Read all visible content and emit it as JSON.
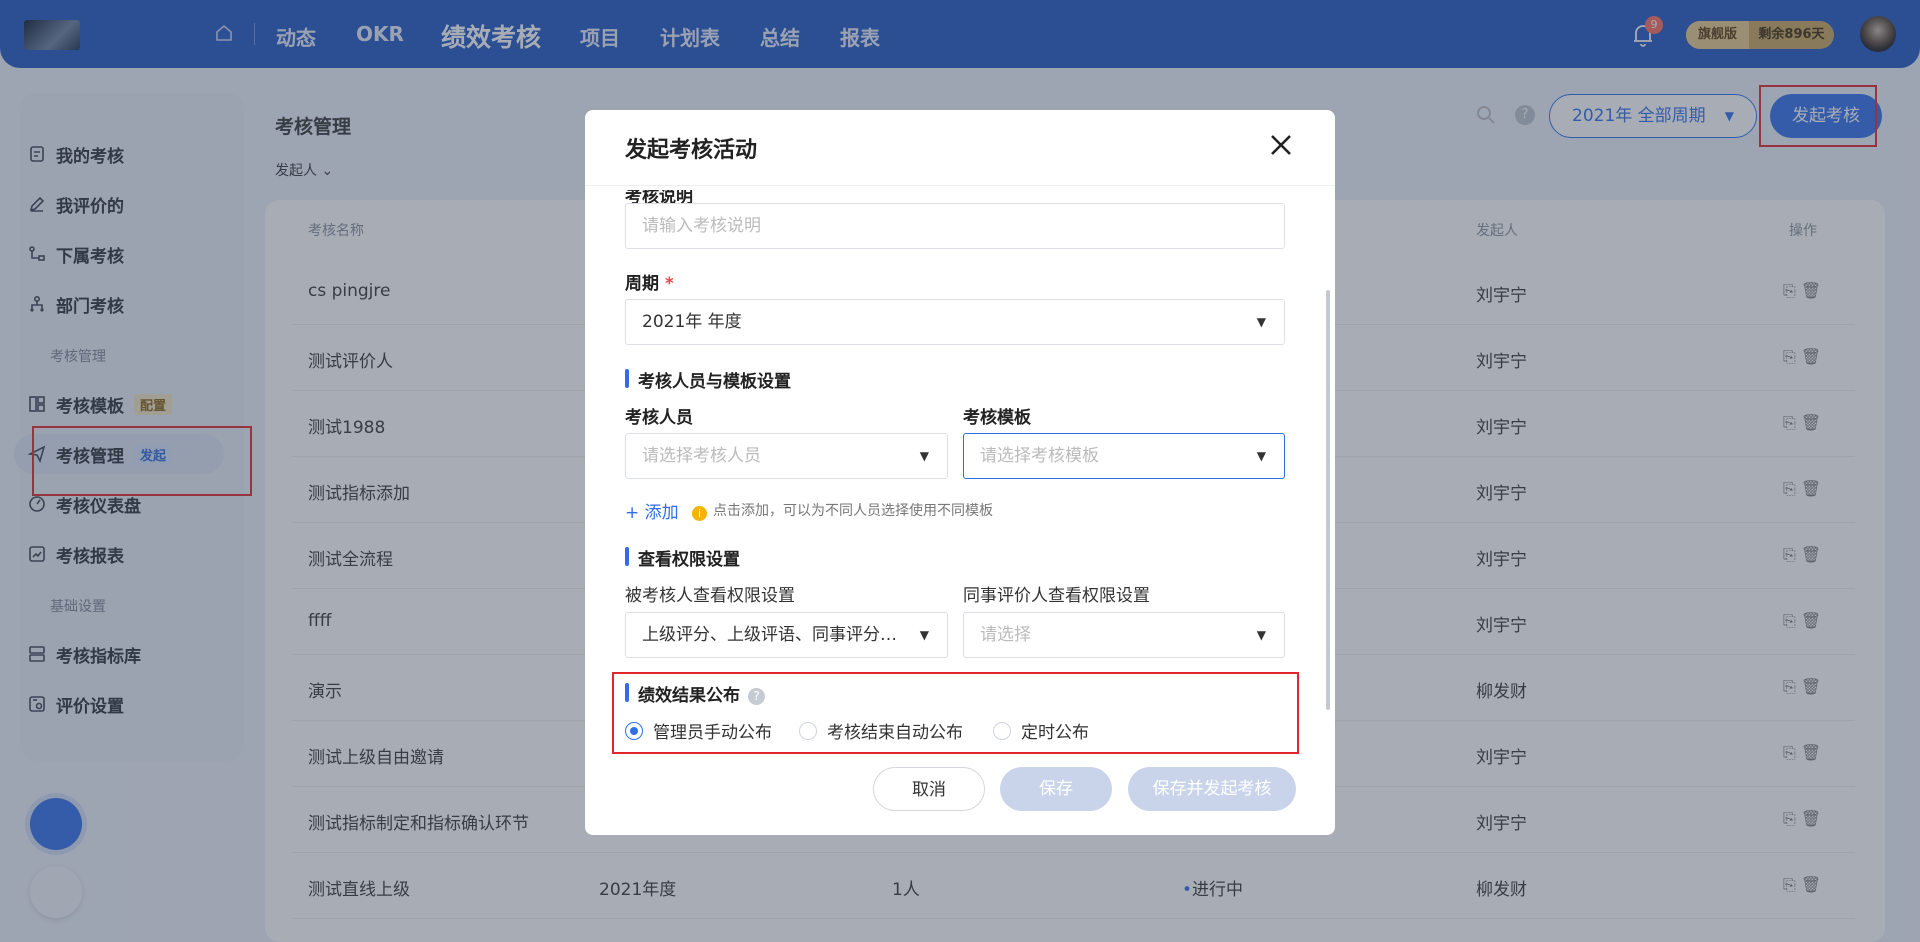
{
  "header": {
    "nav": [
      "动态",
      "OKR",
      "绩效考核",
      "项目",
      "计划表",
      "总结",
      "报表"
    ],
    "active_nav": "绩效考核",
    "notification_count": "9",
    "plan_label": "旗舰版",
    "plan_remaining": "剩余896天"
  },
  "sidebar": {
    "items": [
      {
        "label": "我的考核",
        "icon": "clipboard-icon"
      },
      {
        "label": "我评价的",
        "icon": "pen-icon"
      },
      {
        "label": "下属考核",
        "icon": "org-branch-icon"
      },
      {
        "label": "部门考核",
        "icon": "department-icon"
      }
    ],
    "group1": "考核管理",
    "group1_items": [
      {
        "label": "考核模板",
        "tag": "配置",
        "icon": "template-icon"
      },
      {
        "label": "考核管理",
        "tag": "发起",
        "icon": "send-icon"
      },
      {
        "label": "考核仪表盘",
        "icon": "gauge-icon"
      },
      {
        "label": "考核报表",
        "icon": "report-icon"
      }
    ],
    "group2": "基础设置",
    "group2_items": [
      {
        "label": "考核指标库",
        "icon": "indicator-library-icon"
      },
      {
        "label": "评价设置",
        "icon": "settings-icon"
      }
    ]
  },
  "main": {
    "title": "考核管理",
    "filter_label": "发起人",
    "period_select": "2021年 全部周期",
    "launch_button": "发起考核",
    "columns": {
      "name": "考核名称",
      "initiator": "发起人",
      "ops": "操作"
    },
    "rows": [
      {
        "name": "cs pingjre",
        "initiator": "刘宇宁"
      },
      {
        "name": "测试评价人",
        "initiator": "刘宇宁"
      },
      {
        "name": "测试1988",
        "initiator": "刘宇宁"
      },
      {
        "name": "测试指标添加",
        "initiator": "刘宇宁"
      },
      {
        "name": "测试全流程",
        "initiator": "刘宇宁"
      },
      {
        "name": "ffff",
        "initiator": "刘宇宁"
      },
      {
        "name": "演示",
        "initiator": "柳发财"
      },
      {
        "name": "测试上级自由邀请",
        "initiator": "刘宇宁"
      },
      {
        "name": "测试指标制定和指标确认环节",
        "initiator": "刘宇宁"
      },
      {
        "name": "测试直线上级",
        "period": "2021年度",
        "count": "1人",
        "status": "进行中",
        "initiator": "柳发财"
      }
    ]
  },
  "modal": {
    "title": "发起考核活动",
    "desc_label": "考核说明",
    "desc_placeholder": "请输入考核说明",
    "period_label": "周期",
    "period_required": "*",
    "period_value": "2021年 年度",
    "section_people": "考核人员与模板设置",
    "people_label": "考核人员",
    "people_placeholder": "请选择考核人员",
    "template_label": "考核模板",
    "template_placeholder": "请选择考核模板",
    "add_link": "+ 添加",
    "add_tip": "点击添加，可以为不同人员选择使用不同模板",
    "section_perm": "查看权限设置",
    "reviewee_perm_label": "被考核人查看权限设置",
    "reviewee_perm_value": "上级评分、上级评语、同事评分…",
    "peer_perm_label": "同事评价人查看权限设置",
    "peer_perm_placeholder": "请选择",
    "section_publish": "绩效结果公布",
    "publish_options": [
      "管理员手动公布",
      "考核结束自动公布",
      "定时公布"
    ],
    "publish_selected": 0,
    "btn_cancel": "取消",
    "btn_save": "保存",
    "btn_save_launch": "保存并发起考核"
  },
  "colors": {
    "brand": "#2056c2",
    "accent": "#2f6ee8",
    "highlight_box": "#e3262b"
  }
}
